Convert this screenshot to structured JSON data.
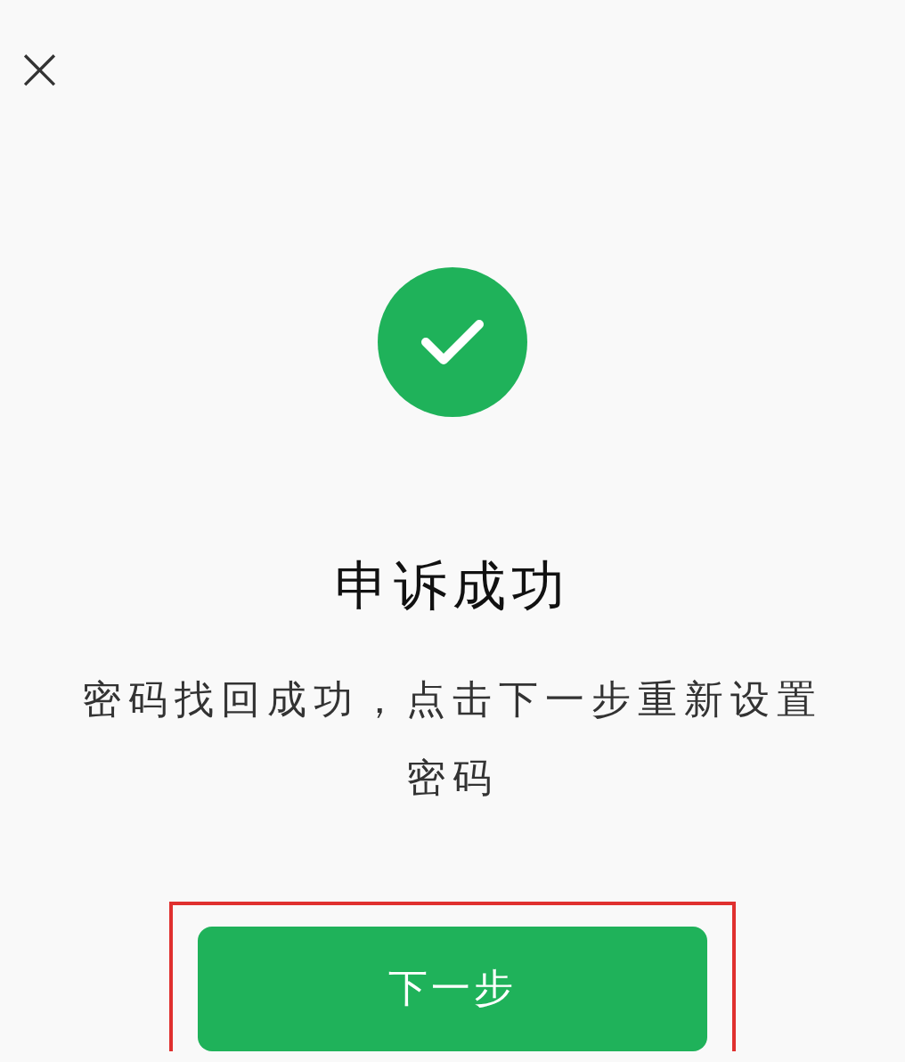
{
  "close_button": {
    "label": "×"
  },
  "status": {
    "kind": "success"
  },
  "title": "申诉成功",
  "message": "密码找回成功，点击下一步重新设置密码",
  "next_button": {
    "label": "下一步",
    "highlighted": true
  }
}
